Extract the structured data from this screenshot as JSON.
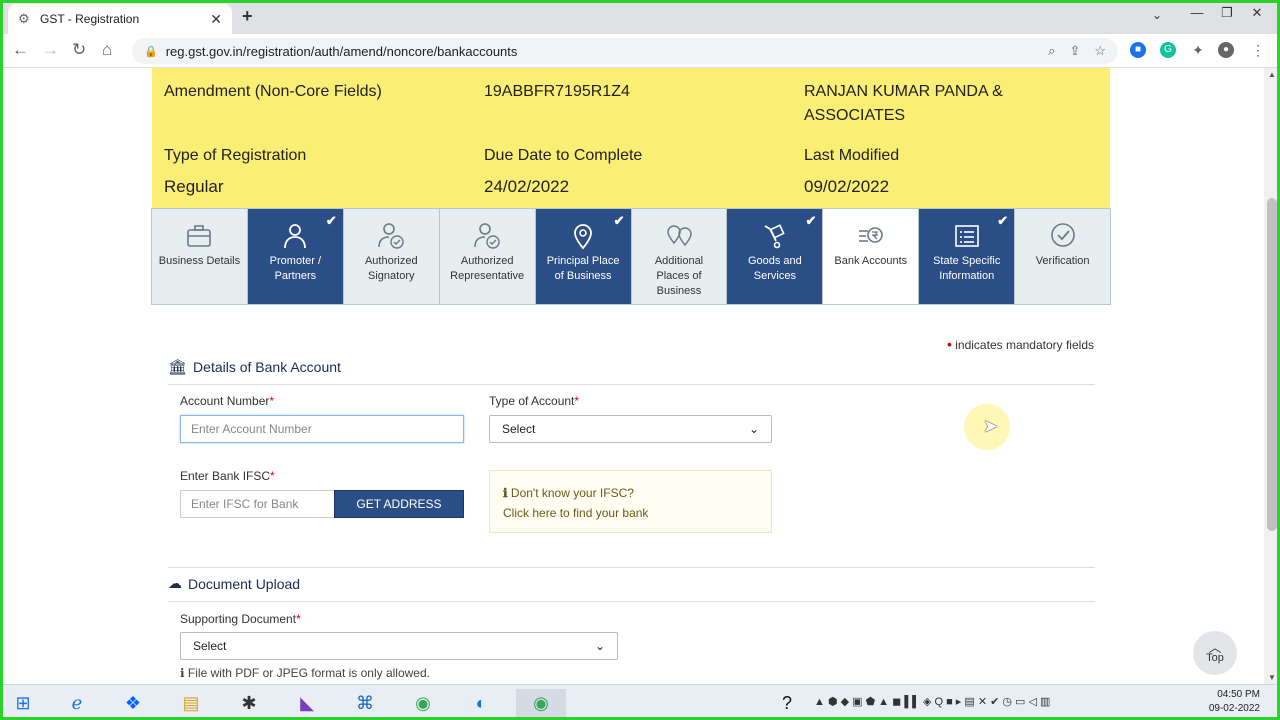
{
  "browser": {
    "tab_title": "GST - Registration",
    "tab_close": "✕",
    "new_tab": "+",
    "url": "reg.gst.gov.in/registration/auth/amend/noncore/bankaccounts",
    "window_controls": [
      "—",
      "❐",
      "✕"
    ]
  },
  "info": {
    "amendment_type": "Amendment (Non-Core Fields)",
    "gstin": "19ABBFR7195R1Z4",
    "legal_name": "RANJAN KUMAR PANDA & ASSOCIATES",
    "type_label": "Type of Registration",
    "type_value": "Regular",
    "due_label": "Due Date to Complete",
    "due_value": "24/02/2022",
    "modified_label": "Last Modified",
    "modified_value": "09/02/2022"
  },
  "steps": [
    {
      "label": "Business Details",
      "state": "default",
      "icon": "briefcase-icon"
    },
    {
      "label": "Promoter / Partners",
      "state": "done",
      "icon": "person-icon"
    },
    {
      "label": "Authorized Signatory",
      "state": "default",
      "icon": "person-check-icon"
    },
    {
      "label": "Authorized Representative",
      "state": "default",
      "icon": "person-check-icon"
    },
    {
      "label": "Principal Place of Business",
      "state": "done",
      "icon": "map-pin-icon"
    },
    {
      "label": "Additional Places of Business",
      "state": "default",
      "icon": "map-pins-icon"
    },
    {
      "label": "Goods and Services",
      "state": "done",
      "icon": "cart-icon"
    },
    {
      "label": "Bank Accounts",
      "state": "active",
      "icon": "bank-rupee-icon"
    },
    {
      "label": "State Specific Information",
      "state": "done",
      "icon": "list-icon"
    },
    {
      "label": "Verification",
      "state": "default",
      "icon": "check-circle-icon"
    }
  ],
  "form": {
    "mandatory_note": "indicates mandatory fields",
    "bank_section_title": "Details of Bank Account",
    "account_number_label": "Account Number",
    "account_number_placeholder": "Enter Account Number",
    "account_type_label": "Type of Account",
    "account_type_value": "Select",
    "ifsc_label": "Enter Bank IFSC",
    "ifsc_placeholder": "Enter IFSC for Bank",
    "get_address": "GET ADDRESS",
    "hint_title": "Don't know your IFSC?",
    "hint_link_pre": "Click ",
    "hint_link": "here",
    "hint_link_post": " to find your bank",
    "upload_section_title": "Document Upload",
    "supporting_doc_label": "Supporting Document",
    "supporting_doc_value": "Select",
    "file_note": "File with PDF or JPEG format is only allowed.",
    "top_label": "Top"
  },
  "taskbar": {
    "time": "04:50 PM",
    "date": "09-02-2022"
  },
  "colors": {
    "info_bg": "#fbee74",
    "step_done": "#2c4e86",
    "accent_border": "#2bd22b"
  }
}
